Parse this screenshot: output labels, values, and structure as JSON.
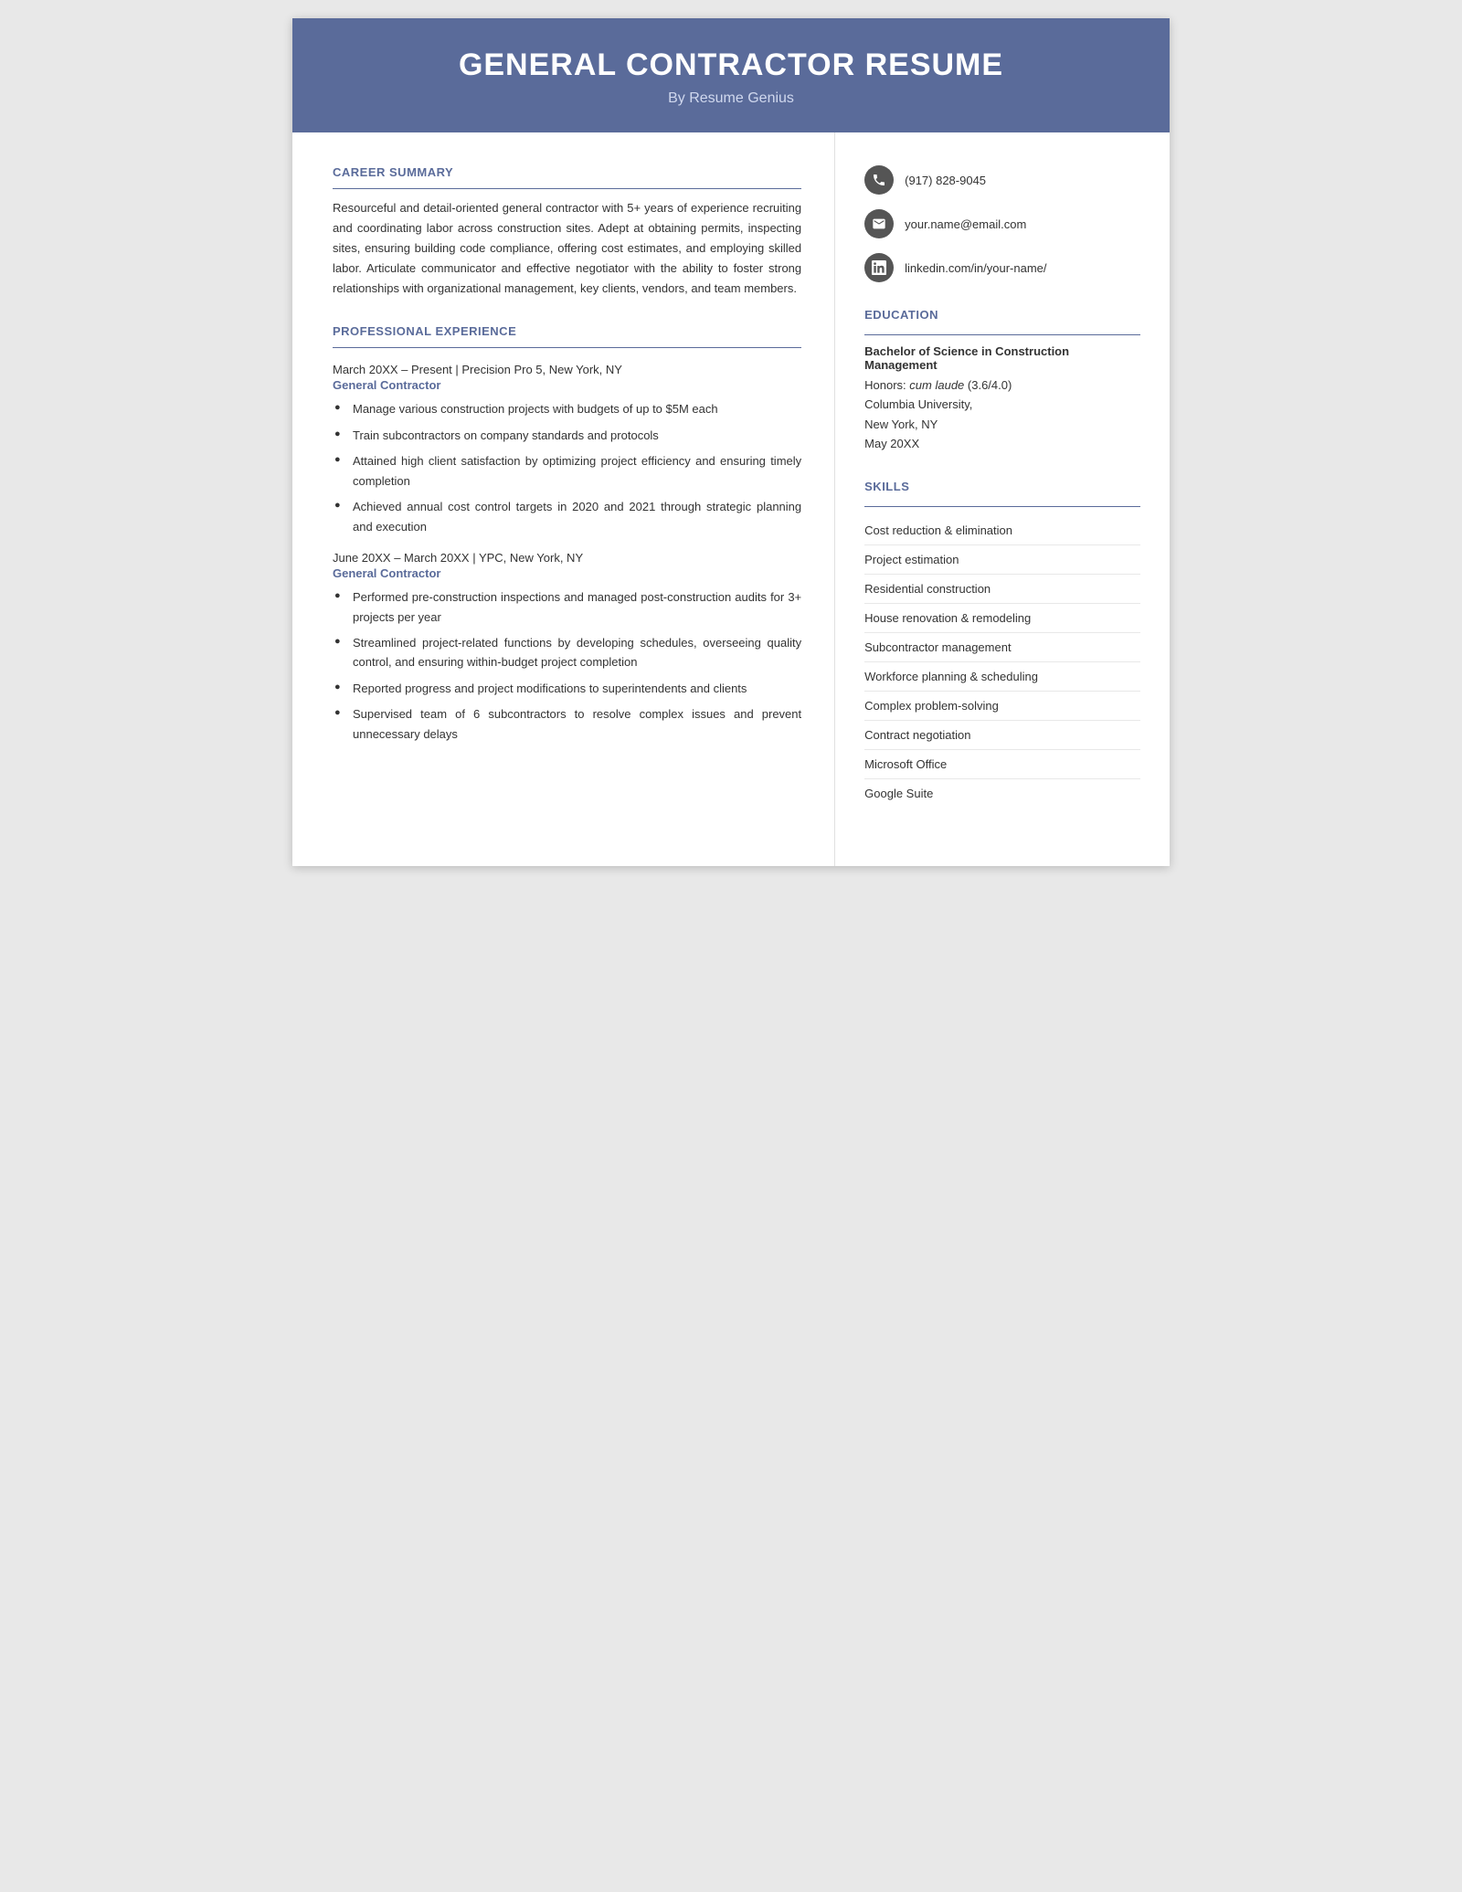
{
  "header": {
    "main_title": "GENERAL CONTRACTOR RESUME",
    "subtitle": "By Resume Genius"
  },
  "contact": {
    "phone": "(917) 828-9045",
    "email": "your.name@email.com",
    "linkedin": "linkedin.com/in/your-name/"
  },
  "career_summary": {
    "section_title": "CAREER SUMMARY",
    "text": "Resourceful and detail-oriented general contractor with 5+ years of experience recruiting and coordinating labor across construction sites. Adept at obtaining permits, inspecting sites, ensuring building code compliance, offering cost estimates, and employing skilled labor. Articulate communicator and effective negotiator with the ability to foster strong relationships with organizational management, key clients, vendors, and team members."
  },
  "professional_experience": {
    "section_title": "PROFESSIONAL EXPERIENCE",
    "jobs": [
      {
        "date_location": "March 20XX – Present | Precision Pro 5, New York, NY",
        "title": "General Contractor",
        "bullets": [
          "Manage various construction projects with budgets of up to $5M each",
          "Train subcontractors on company standards and protocols",
          "Attained high client satisfaction by optimizing project efficiency and ensuring timely completion",
          "Achieved annual cost control targets in 2020 and 2021 through strategic planning and execution"
        ]
      },
      {
        "date_location": "June 20XX – March 20XX | YPC, New York, NY",
        "title": "General Contractor",
        "bullets": [
          "Performed pre-construction inspections and managed post-construction audits for 3+ projects per year",
          "Streamlined project-related functions by developing schedules, overseeing quality control, and ensuring within-budget project completion",
          "Reported progress and project modifications to superintendents and clients",
          "Supervised team of 6 subcontractors to resolve complex issues and prevent unnecessary delays"
        ]
      }
    ]
  },
  "education": {
    "section_title": "EDUCATION",
    "degree": "Bachelor of Science in Construction Management",
    "honors_label": "Honors:",
    "honors": "cum laude",
    "gpa": "(3.6/4.0)",
    "school": "Columbia University,",
    "location": "New York, NY",
    "date": "May 20XX"
  },
  "skills": {
    "section_title": "SKILLS",
    "items": [
      "Cost reduction & elimination",
      "Project estimation",
      "Residential construction",
      "House renovation & remodeling",
      "Subcontractor management",
      "Workforce planning & scheduling",
      "Complex problem-solving",
      "Contract negotiation",
      "Microsoft Office",
      "Google Suite"
    ]
  }
}
